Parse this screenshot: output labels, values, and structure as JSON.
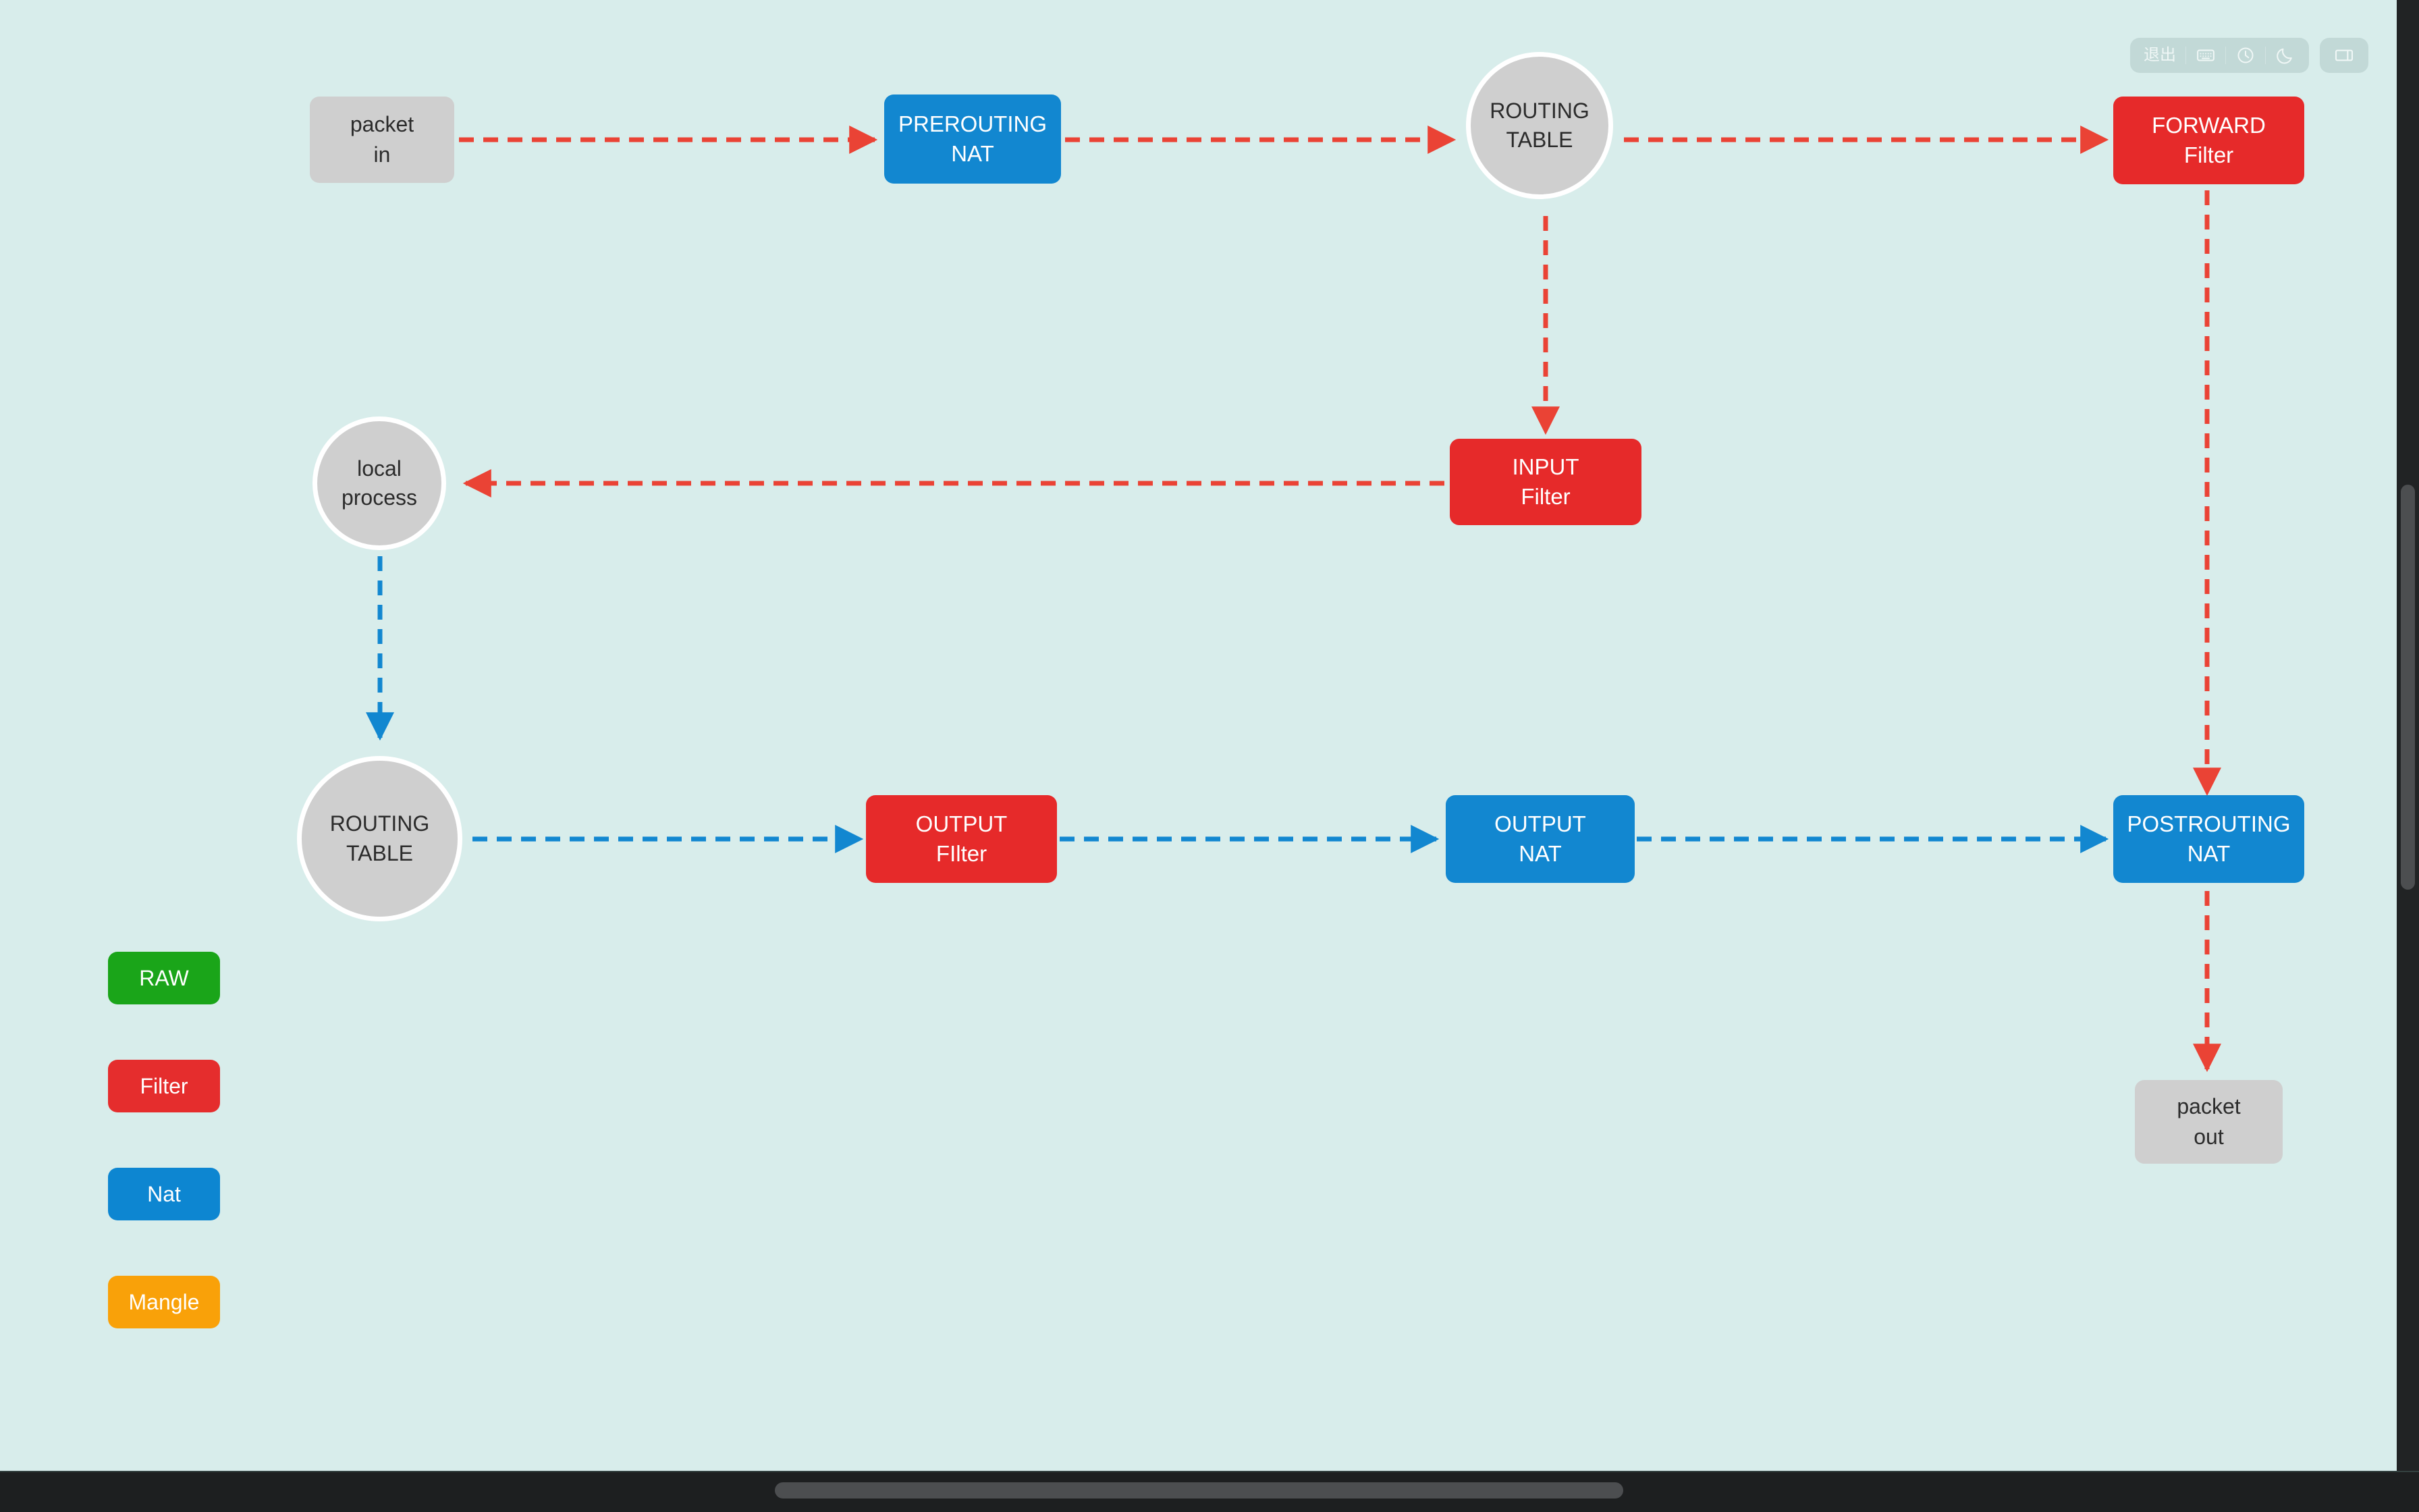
{
  "toolbar": {
    "exit_label": "退出",
    "buttons": [
      {
        "name": "exit-button",
        "kind": "text"
      },
      {
        "name": "keyboard-icon",
        "kind": "icon"
      },
      {
        "name": "clock-icon",
        "kind": "icon"
      },
      {
        "name": "moon-icon",
        "kind": "icon"
      },
      {
        "name": "panel-layout-icon",
        "kind": "icon"
      }
    ]
  },
  "colors": {
    "background": "#d8edeb",
    "nat_blue": "#1287d0",
    "filter_red": "#e62a2a",
    "raw_green": "#1aa519",
    "mangle_orange": "#f9a109",
    "neutral_gray": "#cfcfcf",
    "red_flow": "#ea4335",
    "blue_flow": "#1287d0"
  },
  "diagram": {
    "nodes": {
      "packet_in": {
        "line1": "packet",
        "line2": "in"
      },
      "prerouting_nat": {
        "line1": "PREROUTING",
        "line2": "NAT"
      },
      "routing_table_top": {
        "line1": "ROUTING",
        "line2": "TABLE"
      },
      "forward_filter": {
        "line1": "FORWARD",
        "line2": "Filter"
      },
      "local_process": {
        "line1": "local",
        "line2": "process"
      },
      "input_filter": {
        "line1": "INPUT",
        "line2": "Filter"
      },
      "routing_table_bottom": {
        "line1": "ROUTING",
        "line2": "TABLE"
      },
      "output_filter": {
        "line1": "OUTPUT",
        "line2": "FIlter"
      },
      "output_nat": {
        "line1": "OUTPUT",
        "line2": "NAT"
      },
      "postrouting_nat": {
        "line1": "POSTROUTING",
        "line2": "NAT"
      },
      "packet_out": {
        "line1": "packet",
        "line2": "out"
      }
    }
  },
  "legend": {
    "items": [
      {
        "label": "RAW",
        "color": "#1aa519"
      },
      {
        "label": "Filter",
        "color": "#e52d2d"
      },
      {
        "label": "Nat",
        "color": "#0d86d1"
      },
      {
        "label": "Mangle",
        "color": "#f9a109"
      }
    ]
  }
}
